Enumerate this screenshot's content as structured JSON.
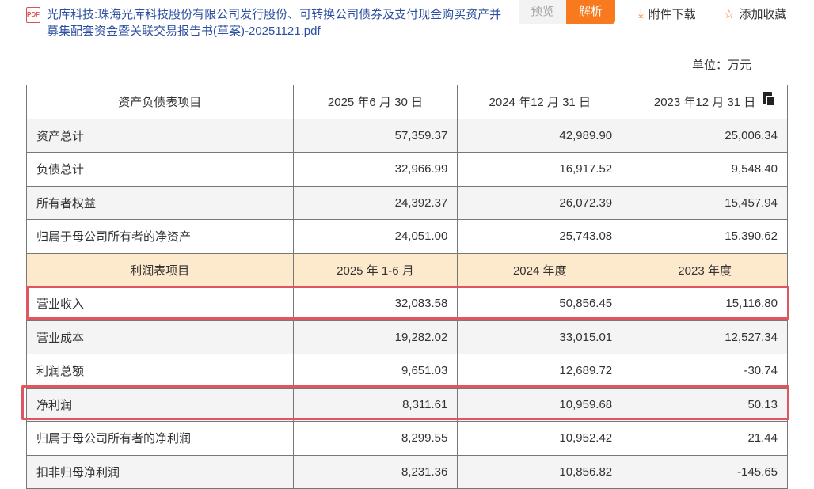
{
  "header": {
    "title": "光库科技:珠海光库科技股份有限公司发行股份、可转换公司债券及支付现金购买资产并募集配套资金暨关联交易报告书(草案)-20251121.pdf",
    "preview_label": "预览",
    "parse_label": "解析",
    "download_label": "附件下载",
    "favorite_label": "添加收藏"
  },
  "unit": "单位：万元",
  "balance": {
    "headers": [
      "资产负债表项目",
      "2025 年6 月 30 日",
      "2024 年12 月 31 日",
      "2023 年12 月 31 日"
    ],
    "rows": [
      [
        "资产总计",
        "57,359.37",
        "42,989.90",
        "25,006.34"
      ],
      [
        "负债总计",
        "32,966.99",
        "16,917.52",
        "9,548.40"
      ],
      [
        "所有者权益",
        "24,392.37",
        "26,072.39",
        "15,457.94"
      ],
      [
        "归属于母公司所有者的净资产",
        "24,051.00",
        "25,743.08",
        "15,390.62"
      ]
    ]
  },
  "income": {
    "headers": [
      "利润表项目",
      "2025 年 1-6 月",
      "2024 年度",
      "2023 年度"
    ],
    "rows": [
      [
        "营业收入",
        "32,083.58",
        "50,856.45",
        "15,116.80"
      ],
      [
        "营业成本",
        "19,282.02",
        "33,015.01",
        "12,527.34"
      ],
      [
        "利润总额",
        "9,651.03",
        "12,689.72",
        "-30.74"
      ],
      [
        "净利润",
        "8,311.61",
        "10,959.68",
        "50.13"
      ],
      [
        "归属于母公司所有者的净利润",
        "8,299.55",
        "10,952.42",
        "21.44"
      ],
      [
        "扣非归母净利润",
        "8,231.36",
        "10,856.82",
        "-145.65"
      ]
    ]
  },
  "colors": {
    "accent": "#f97a1e",
    "highlight": "#e05560",
    "header_bg": "#fde9cc"
  }
}
